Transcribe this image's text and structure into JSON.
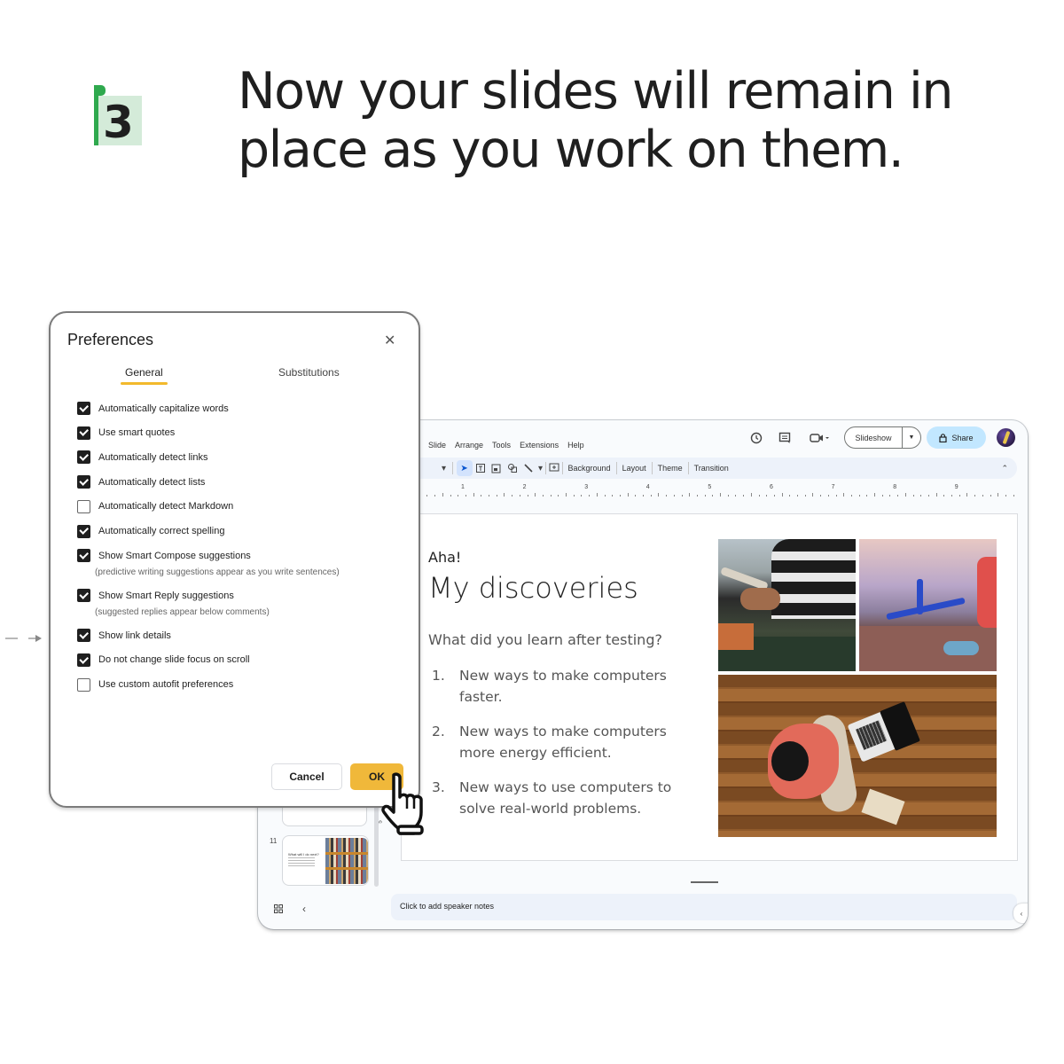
{
  "step": {
    "number": "3",
    "flag_color": "#2fa94e",
    "badge_bg": "#d4ebd9"
  },
  "headline": "Now your slides will remain in place as you work on them.",
  "app": {
    "menu": [
      "Slide",
      "Arrange",
      "Tools",
      "Extensions",
      "Help"
    ],
    "top_icons": [
      "history-icon",
      "comment-icon",
      "video-call-icon"
    ],
    "slideshow_label": "Slideshow",
    "share_label": "Share",
    "share_color": "#c2e7ff",
    "toolbar": {
      "partial_label": "t",
      "background": "Background",
      "layout": "Layout",
      "theme": "Theme",
      "transition": "Transition"
    },
    "ruler_numbers": [
      "1",
      "2",
      "3",
      "4",
      "5",
      "6",
      "7",
      "8",
      "9"
    ],
    "vruler_number": "5",
    "slide": {
      "kicker": "Aha!",
      "title": "My discoveries",
      "question": "What did you learn after testing?",
      "list": [
        {
          "n": "1.",
          "text": "New ways to make computers faster."
        },
        {
          "n": "2.",
          "text": "New ways to make computers more energy efficient."
        },
        {
          "n": "3.",
          "text": "New ways to use computers to solve real-world problems."
        }
      ]
    },
    "filmstrip": {
      "slide_number": "11",
      "thumb_title": "What will I do next?"
    },
    "speaker_notes_placeholder": "Click to add speaker notes"
  },
  "dialog": {
    "title": "Preferences",
    "tabs": [
      {
        "label": "General",
        "active": true
      },
      {
        "label": "Substitutions",
        "active": false
      }
    ],
    "options": [
      {
        "label": "Automatically capitalize words",
        "checked": true
      },
      {
        "label": "Use smart quotes",
        "checked": true
      },
      {
        "label": "Automatically detect links",
        "checked": true
      },
      {
        "label": "Automatically detect lists",
        "checked": true
      },
      {
        "label": "Automatically detect Markdown",
        "checked": false
      },
      {
        "label": "Automatically correct spelling",
        "checked": true
      },
      {
        "label": "Show Smart Compose suggestions",
        "checked": true,
        "hint": "(predictive writing suggestions appear as you write sentences)"
      },
      {
        "label": "Show Smart Reply suggestions",
        "checked": true,
        "hint": "(suggested replies appear below comments)"
      },
      {
        "label": "Show link details",
        "checked": true
      },
      {
        "label": "Do not change slide focus on scroll",
        "checked": true
      },
      {
        "label": "Use custom autofit preferences",
        "checked": false
      }
    ],
    "cancel_label": "Cancel",
    "ok_label": "OK",
    "ok_color": "#f0b83a",
    "tab_underline_color": "#f2b92c"
  }
}
